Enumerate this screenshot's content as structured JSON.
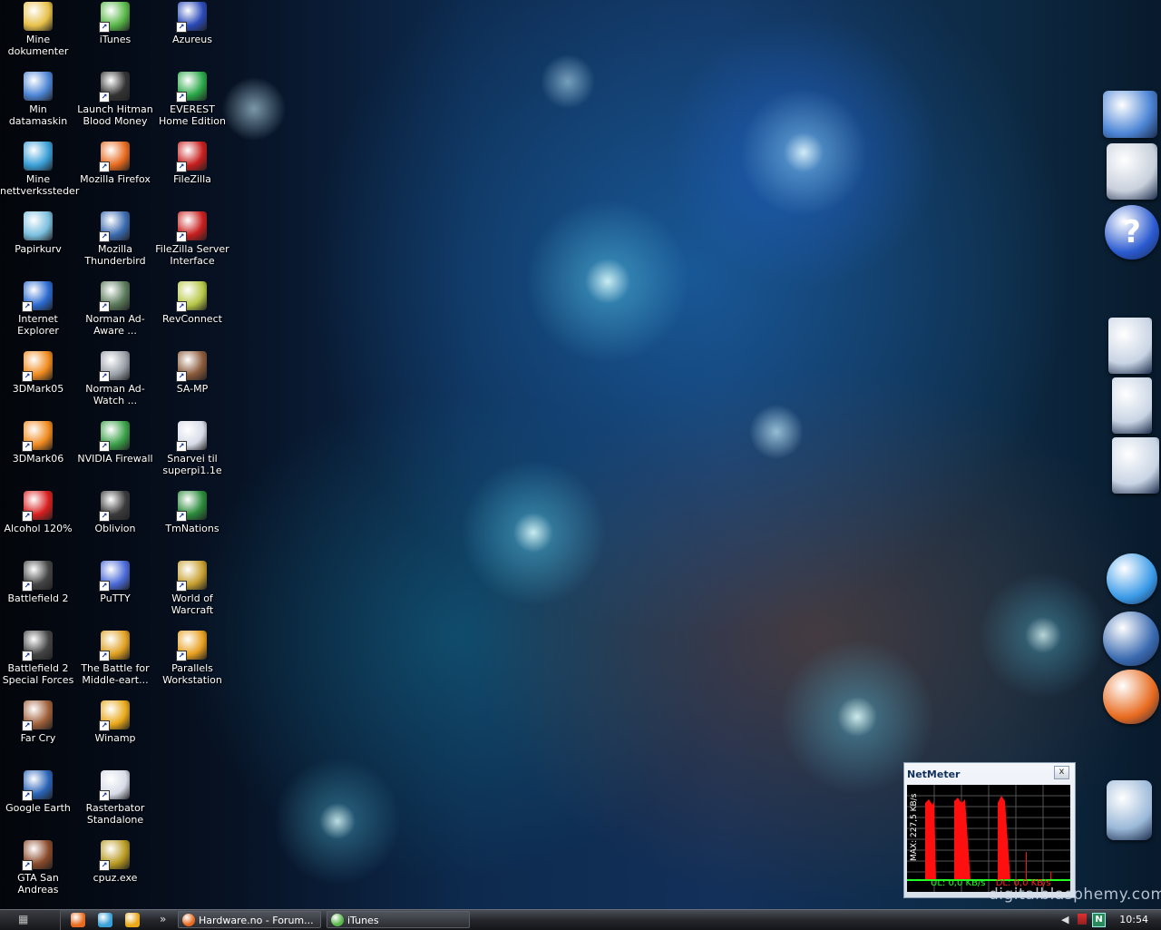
{
  "desktop": {
    "icons": [
      {
        "label": "Mine dokumenter",
        "icon": "folder-documents-icon",
        "color": "#e8c14a"
      },
      {
        "label": "Min datamaskin",
        "icon": "computer-icon",
        "color": "#4d86d6"
      },
      {
        "label": "Mine nettverkssteder",
        "icon": "network-icon",
        "color": "#3aa0d8"
      },
      {
        "label": "Papirkurv",
        "icon": "recycle-bin-icon",
        "color": "#7bc0e0"
      },
      {
        "label": "Internet Explorer",
        "icon": "ie-icon",
        "color": "#2a6ad0"
      },
      {
        "label": "3DMark05",
        "icon": "3dmark-icon",
        "color": "#f08a1e"
      },
      {
        "label": "3DMark06",
        "icon": "3dmark-icon",
        "color": "#f08a1e"
      },
      {
        "label": "Alcohol 120%",
        "icon": "alcohol-icon",
        "color": "#d81e1e"
      },
      {
        "label": "Battlefield 2",
        "icon": "battlefield-icon",
        "color": "#444444"
      },
      {
        "label": "Battlefield 2 Special Forces",
        "icon": "battlefield-icon",
        "color": "#444444"
      },
      {
        "label": "Far Cry",
        "icon": "farcry-icon",
        "color": "#a0603a"
      },
      {
        "label": "Google Earth",
        "icon": "google-earth-icon",
        "color": "#2a64b8"
      },
      {
        "label": "GTA San Andreas",
        "icon": "gta-icon",
        "color": "#8a4a2a"
      },
      {
        "label": "iTunes",
        "icon": "itunes-icon",
        "color": "#58b848"
      },
      {
        "label": "Launch Hitman Blood Money",
        "icon": "hitman-icon",
        "color": "#333333"
      },
      {
        "label": "Mozilla Firefox",
        "icon": "firefox-icon",
        "color": "#e86a1e"
      },
      {
        "label": "Mozilla Thunderbird",
        "icon": "thunderbird-icon",
        "color": "#3a6ab0"
      },
      {
        "label": "Norman Ad-Aware ...",
        "icon": "adaware-icon",
        "color": "#5a7a5a"
      },
      {
        "label": "Norman Ad-Watch ...",
        "icon": "adwatch-icon",
        "color": "#9aa0a8"
      },
      {
        "label": "NVIDIA Firewall",
        "icon": "nvidia-firewall-icon",
        "color": "#3aa048"
      },
      {
        "label": "Oblivion",
        "icon": "oblivion-icon",
        "color": "#3a3a3a"
      },
      {
        "label": "PuTTY",
        "icon": "putty-icon",
        "color": "#4a6ad8"
      },
      {
        "label": "The Battle for Middle-eart...",
        "icon": "bfme-icon",
        "color": "#e0a020"
      },
      {
        "label": "Winamp",
        "icon": "winamp-icon",
        "color": "#e8a818"
      },
      {
        "label": "Rasterbator Standalone",
        "icon": "file-icon",
        "color": "#d8dce8"
      },
      {
        "label": "cpuz.exe",
        "icon": "chip-icon",
        "color": "#b89a20"
      },
      {
        "label": "Azureus",
        "icon": "azureus-icon",
        "color": "#2a4ab8"
      },
      {
        "label": "EVEREST Home Edition",
        "icon": "everest-icon",
        "color": "#2aa848"
      },
      {
        "label": "FileZilla",
        "icon": "filezilla-icon",
        "color": "#c81e1e"
      },
      {
        "label": "FileZilla Server Interface",
        "icon": "filezilla-server-icon",
        "color": "#c81e1e"
      },
      {
        "label": "RevConnect",
        "icon": "revconnect-icon",
        "color": "#b8c848"
      },
      {
        "label": "SA-MP",
        "icon": "samp-icon",
        "color": "#8a5a3a"
      },
      {
        "label": "Snarvei til superpi1.1e",
        "icon": "file-icon",
        "color": "#d8dce8"
      },
      {
        "label": "TmNations",
        "icon": "tmnations-icon",
        "color": "#2a8a3a"
      },
      {
        "label": "World of Warcraft",
        "icon": "wow-icon",
        "color": "#c8a030"
      },
      {
        "label": "Parallels Workstation",
        "icon": "parallels-icon",
        "color": "#e8a020"
      }
    ]
  },
  "dock": {
    "items": [
      {
        "icon": "computer-icon",
        "color": "#4d86d6"
      },
      {
        "icon": "scanner-icon",
        "color": "#c8d0dc"
      },
      {
        "icon": "help-icon",
        "color": "#2a5ad0"
      },
      {
        "icon": "folder-icon",
        "color": "#c8d4e4"
      },
      {
        "icon": "documents-folder-icon",
        "color": "#c8d4e4"
      },
      {
        "icon": "music-folder-icon",
        "color": "#c8d4e4"
      },
      {
        "icon": "media-player-icon",
        "color": "#3a9ae8"
      },
      {
        "icon": "thunderbird-icon",
        "color": "#3a6ab0"
      },
      {
        "icon": "firefox-icon",
        "color": "#e86a1e"
      },
      {
        "icon": "trash-icon",
        "color": "#9ab8d8"
      }
    ]
  },
  "netmeter": {
    "title": "NetMeter",
    "close_label": "x",
    "max_label": "MAX: 227,5 KB/s",
    "ul_label": "UL: 0,0 KB/s",
    "dl_label": "DL: 0,0 KB/s"
  },
  "watermark": "digitalblasphemy.com",
  "taskbar": {
    "more_label": "»",
    "tasks": [
      {
        "label": "Hardware.no - Forum...",
        "icon": "firefox-icon",
        "color": "#e86a1e"
      },
      {
        "label": "iTunes",
        "icon": "itunes-icon",
        "color": "#58b848"
      }
    ],
    "quick_launch": [
      {
        "icon": "firefox-icon",
        "color": "#e86a1e"
      },
      {
        "icon": "network-icon",
        "color": "#3aa0d8"
      },
      {
        "icon": "winamp-icon",
        "color": "#e8a818"
      }
    ],
    "clock": "10:54"
  }
}
